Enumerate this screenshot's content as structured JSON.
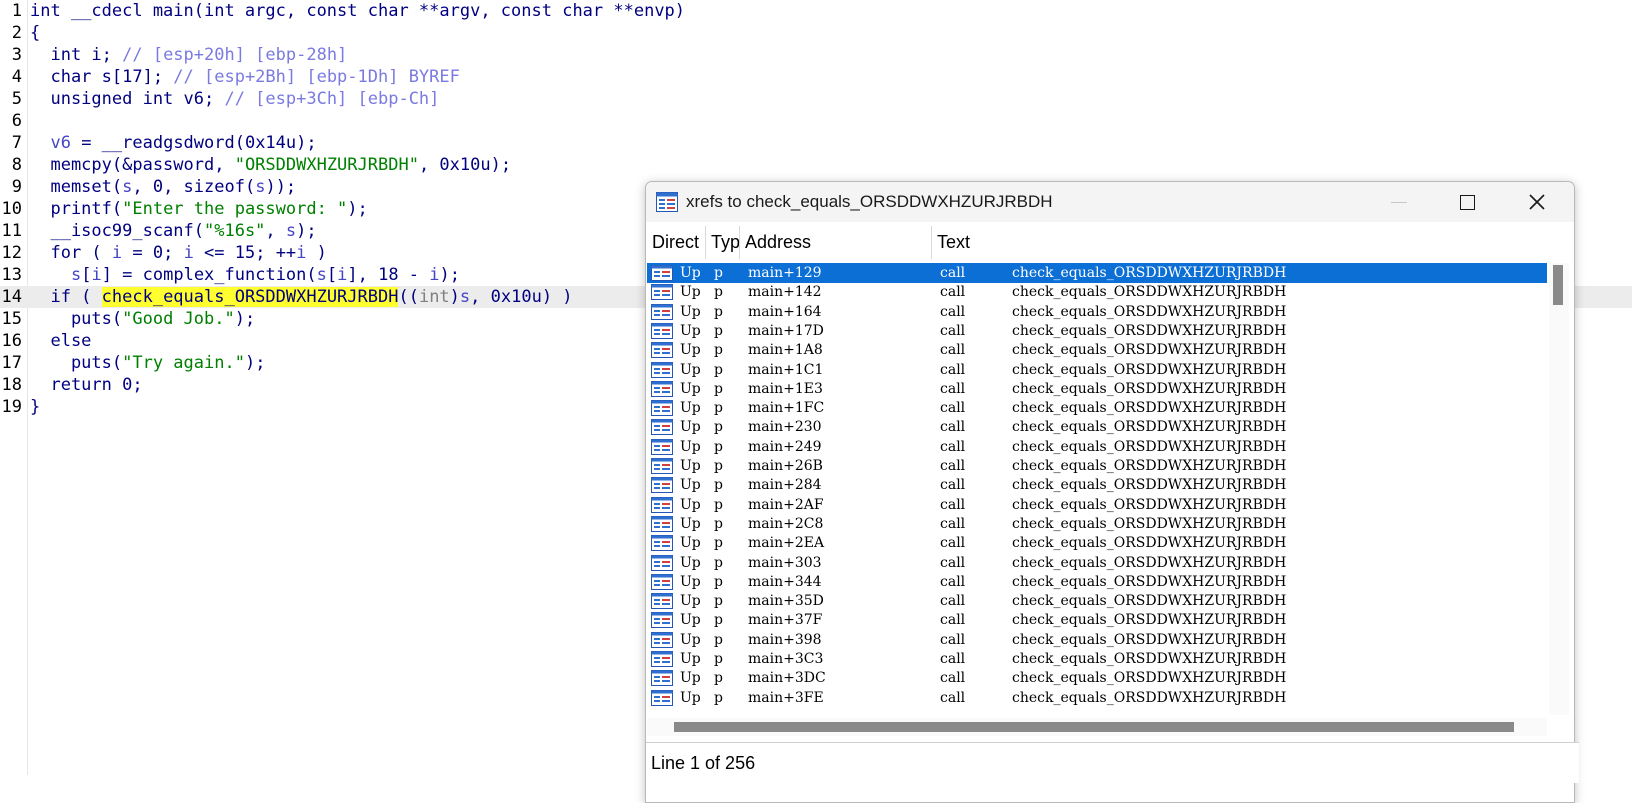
{
  "code": {
    "lines": [
      {
        "num": "1",
        "tokens": [
          {
            "t": "int __cdecl main(int argc, const char **argv, const char **envp)"
          }
        ]
      },
      {
        "num": "2",
        "tokens": [
          {
            "t": "{"
          }
        ]
      },
      {
        "num": "3",
        "tokens": [
          {
            "t": "  int i; "
          },
          {
            "t": "// [esp+20h] [ebp-28h]",
            "c": "t-cm"
          }
        ]
      },
      {
        "num": "4",
        "tokens": [
          {
            "t": "  char s[17]; "
          },
          {
            "t": "// [esp+2Bh] [ebp-1Dh] BYREF",
            "c": "t-cm"
          }
        ]
      },
      {
        "num": "5",
        "tokens": [
          {
            "t": "  unsigned int v6; "
          },
          {
            "t": "// [esp+3Ch] [ebp-Ch]",
            "c": "t-cm"
          }
        ]
      },
      {
        "num": "6",
        "tokens": [
          {
            "t": ""
          }
        ]
      },
      {
        "num": "7",
        "tokens": [
          {
            "t": "  "
          },
          {
            "t": "v6",
            "c": "t-var"
          },
          {
            "t": " = __readgsdword(0x14u);"
          }
        ]
      },
      {
        "num": "8",
        "tokens": [
          {
            "t": "  memcpy(&password, "
          },
          {
            "t": "\"ORSDDWXHZURJRBDH\"",
            "c": "t-str"
          },
          {
            "t": ", 0x10u);"
          }
        ]
      },
      {
        "num": "9",
        "tokens": [
          {
            "t": "  memset("
          },
          {
            "t": "s",
            "c": "t-var"
          },
          {
            "t": ", 0, sizeof("
          },
          {
            "t": "s",
            "c": "t-var"
          },
          {
            "t": "));"
          }
        ]
      },
      {
        "num": "10",
        "tokens": [
          {
            "t": "  printf("
          },
          {
            "t": "\"Enter the password: \"",
            "c": "t-str"
          },
          {
            "t": ");"
          }
        ]
      },
      {
        "num": "11",
        "tokens": [
          {
            "t": "  __isoc99_scanf("
          },
          {
            "t": "\"%16s\"",
            "c": "t-str"
          },
          {
            "t": ", "
          },
          {
            "t": "s",
            "c": "t-var"
          },
          {
            "t": ");"
          }
        ]
      },
      {
        "num": "12",
        "tokens": [
          {
            "t": "  for ( "
          },
          {
            "t": "i",
            "c": "t-var"
          },
          {
            "t": " = 0; "
          },
          {
            "t": "i",
            "c": "t-var"
          },
          {
            "t": " <= 15; ++"
          },
          {
            "t": "i",
            "c": "t-var"
          },
          {
            "t": " )"
          }
        ]
      },
      {
        "num": "13",
        "tokens": [
          {
            "t": "    "
          },
          {
            "t": "s",
            "c": "t-var"
          },
          {
            "t": "["
          },
          {
            "t": "i",
            "c": "t-var"
          },
          {
            "t": "] = complex_function("
          },
          {
            "t": "s",
            "c": "t-var"
          },
          {
            "t": "["
          },
          {
            "t": "i",
            "c": "t-var"
          },
          {
            "t": "], 18 - "
          },
          {
            "t": "i",
            "c": "t-var"
          },
          {
            "t": ");"
          }
        ]
      },
      {
        "num": "14",
        "current": true,
        "tokens": [
          {
            "t": "  if ( "
          },
          {
            "t": "check_equals_ORSDDWXHZURJRBDH",
            "c": "t-fn-hl"
          },
          {
            "t": "(("
          },
          {
            "t": "int",
            "c": "t-cast"
          },
          {
            "t": ")"
          },
          {
            "t": "s",
            "c": "t-var"
          },
          {
            "t": ", 0x10u) )"
          }
        ]
      },
      {
        "num": "15",
        "tokens": [
          {
            "t": "    puts("
          },
          {
            "t": "\"Good Job.\"",
            "c": "t-str"
          },
          {
            "t": ");"
          }
        ]
      },
      {
        "num": "16",
        "tokens": [
          {
            "t": "  else"
          }
        ]
      },
      {
        "num": "17",
        "tokens": [
          {
            "t": "    puts("
          },
          {
            "t": "\"Try again.\"",
            "c": "t-str"
          },
          {
            "t": ");"
          }
        ]
      },
      {
        "num": "18",
        "tokens": [
          {
            "t": "  return 0;"
          }
        ]
      },
      {
        "num": "19",
        "tokens": [
          {
            "t": "}"
          }
        ]
      }
    ]
  },
  "xrefs": {
    "title": "xrefs to check_equals_ORSDDWXHZURJRBDH",
    "icon": "xref-list-icon",
    "controls": {
      "minimize": "minimize-icon",
      "maximize": "maximize-icon",
      "close": "close-icon"
    },
    "columns": [
      "Direct",
      "Typ",
      "Address",
      "Text"
    ],
    "rows": [
      {
        "dir": "Up",
        "typ": "p",
        "addr": "main+129",
        "ins": "call",
        "text": "check_equals_ORSDDWXHZURJRBDH",
        "selected": true
      },
      {
        "dir": "Up",
        "typ": "p",
        "addr": "main+142",
        "ins": "call",
        "text": "check_equals_ORSDDWXHZURJRBDH"
      },
      {
        "dir": "Up",
        "typ": "p",
        "addr": "main+164",
        "ins": "call",
        "text": "check_equals_ORSDDWXHZURJRBDH"
      },
      {
        "dir": "Up",
        "typ": "p",
        "addr": "main+17D",
        "ins": "call",
        "text": "check_equals_ORSDDWXHZURJRBDH"
      },
      {
        "dir": "Up",
        "typ": "p",
        "addr": "main+1A8",
        "ins": "call",
        "text": "check_equals_ORSDDWXHZURJRBDH"
      },
      {
        "dir": "Up",
        "typ": "p",
        "addr": "main+1C1",
        "ins": "call",
        "text": "check_equals_ORSDDWXHZURJRBDH"
      },
      {
        "dir": "Up",
        "typ": "p",
        "addr": "main+1E3",
        "ins": "call",
        "text": "check_equals_ORSDDWXHZURJRBDH"
      },
      {
        "dir": "Up",
        "typ": "p",
        "addr": "main+1FC",
        "ins": "call",
        "text": "check_equals_ORSDDWXHZURJRBDH"
      },
      {
        "dir": "Up",
        "typ": "p",
        "addr": "main+230",
        "ins": "call",
        "text": "check_equals_ORSDDWXHZURJRBDH"
      },
      {
        "dir": "Up",
        "typ": "p",
        "addr": "main+249",
        "ins": "call",
        "text": "check_equals_ORSDDWXHZURJRBDH"
      },
      {
        "dir": "Up",
        "typ": "p",
        "addr": "main+26B",
        "ins": "call",
        "text": "check_equals_ORSDDWXHZURJRBDH"
      },
      {
        "dir": "Up",
        "typ": "p",
        "addr": "main+284",
        "ins": "call",
        "text": "check_equals_ORSDDWXHZURJRBDH"
      },
      {
        "dir": "Up",
        "typ": "p",
        "addr": "main+2AF",
        "ins": "call",
        "text": "check_equals_ORSDDWXHZURJRBDH"
      },
      {
        "dir": "Up",
        "typ": "p",
        "addr": "main+2C8",
        "ins": "call",
        "text": "check_equals_ORSDDWXHZURJRBDH"
      },
      {
        "dir": "Up",
        "typ": "p",
        "addr": "main+2EA",
        "ins": "call",
        "text": "check_equals_ORSDDWXHZURJRBDH"
      },
      {
        "dir": "Up",
        "typ": "p",
        "addr": "main+303",
        "ins": "call",
        "text": "check_equals_ORSDDWXHZURJRBDH"
      },
      {
        "dir": "Up",
        "typ": "p",
        "addr": "main+344",
        "ins": "call",
        "text": "check_equals_ORSDDWXHZURJRBDH"
      },
      {
        "dir": "Up",
        "typ": "p",
        "addr": "main+35D",
        "ins": "call",
        "text": "check_equals_ORSDDWXHZURJRBDH"
      },
      {
        "dir": "Up",
        "typ": "p",
        "addr": "main+37F",
        "ins": "call",
        "text": "check_equals_ORSDDWXHZURJRBDH"
      },
      {
        "dir": "Up",
        "typ": "p",
        "addr": "main+398",
        "ins": "call",
        "text": "check_equals_ORSDDWXHZURJRBDH"
      },
      {
        "dir": "Up",
        "typ": "p",
        "addr": "main+3C3",
        "ins": "call",
        "text": "check_equals_ORSDDWXHZURJRBDH"
      },
      {
        "dir": "Up",
        "typ": "p",
        "addr": "main+3DC",
        "ins": "call",
        "text": "check_equals_ORSDDWXHZURJRBDH"
      },
      {
        "dir": "Up",
        "typ": "p",
        "addr": "main+3FE",
        "ins": "call",
        "text": "check_equals_ORSDDWXHZURJRBDH"
      }
    ],
    "status": "Line 1 of 256",
    "colors": {
      "selection": "#0c6fd6",
      "highlight": "#ffff30",
      "string": "#008000",
      "comment": "#7a7ae0",
      "keyword": "#000080"
    }
  }
}
